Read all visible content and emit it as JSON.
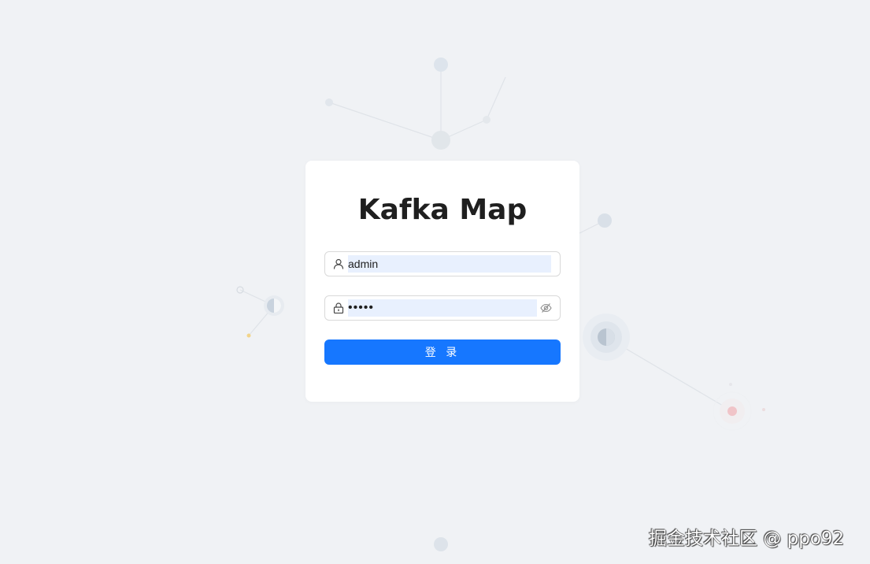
{
  "app": {
    "title": "Kafka Map"
  },
  "login": {
    "username": {
      "value": "admin",
      "icon": "user-icon"
    },
    "password": {
      "value": "admin",
      "icon": "lock-icon",
      "toggle_icon": "eye-invisible-icon"
    },
    "submit_label": "登 录"
  },
  "watermark": {
    "text": "掘金技术社区 @ ppo92"
  },
  "colors": {
    "background": "#f0f2f5",
    "primary": "#1677ff",
    "input_autofill": "#e8f0fe"
  }
}
